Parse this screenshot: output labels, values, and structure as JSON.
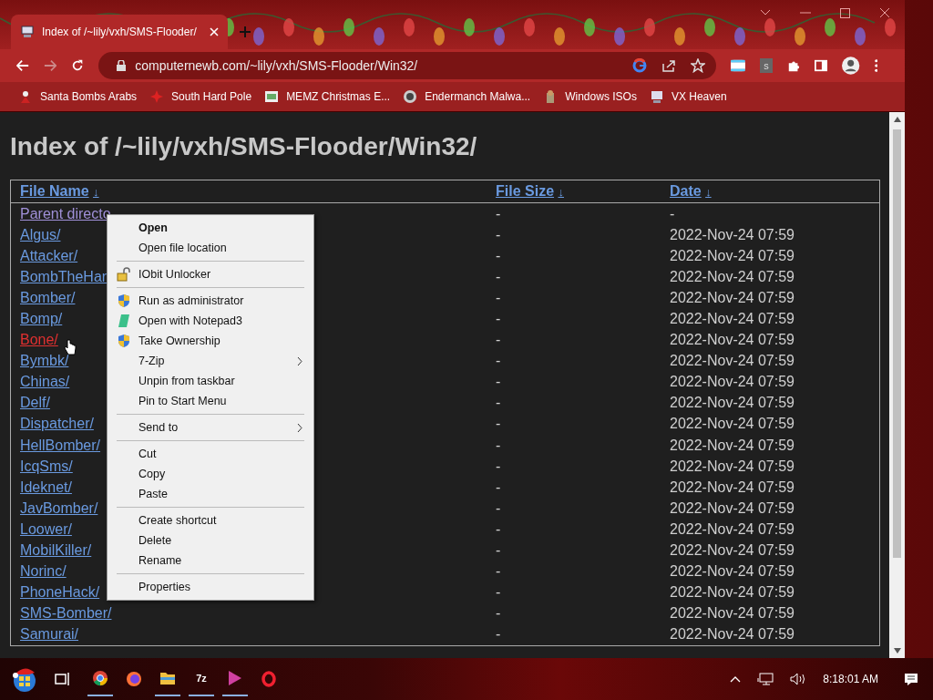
{
  "browser": {
    "tab": {
      "title": "Index of /~lily/vxh/SMS-Flooder/",
      "selected": true
    },
    "address": "computernewb.com/~lily/vxh/SMS-Flooder/Win32/",
    "extension_badge": "s",
    "bookmarks": [
      {
        "label": "Santa Bombs Arabs"
      },
      {
        "label": "South Hard Pole"
      },
      {
        "label": "MEMZ Christmas E..."
      },
      {
        "label": "Endermanch Malwa..."
      },
      {
        "label": "Windows ISOs"
      },
      {
        "label": "VX Heaven"
      }
    ]
  },
  "page": {
    "heading": "Index of /~lily/vxh/SMS-Flooder/Win32/",
    "columns": [
      {
        "label": "File Name",
        "sort": "↓"
      },
      {
        "label": "File Size",
        "sort": "↓"
      },
      {
        "label": "Date",
        "sort": "↓"
      }
    ],
    "rows": [
      {
        "name": "Parent directo",
        "size": "-",
        "date": "-",
        "visited": true,
        "hovered": false
      },
      {
        "name": "Algus/",
        "size": "-",
        "date": "2022-Nov-24 07:59",
        "visited": false,
        "hovered": false
      },
      {
        "name": "Attacker/",
        "size": "-",
        "date": "2022-Nov-24 07:59",
        "visited": false,
        "hovered": false
      },
      {
        "name": "BombTheHar",
        "size": "-",
        "date": "2022-Nov-24 07:59",
        "visited": false,
        "hovered": false
      },
      {
        "name": "Bomber/",
        "size": "-",
        "date": "2022-Nov-24 07:59",
        "visited": false,
        "hovered": false
      },
      {
        "name": "Bomp/",
        "size": "-",
        "date": "2022-Nov-24 07:59",
        "visited": false,
        "hovered": false
      },
      {
        "name": "Bone/",
        "size": "-",
        "date": "2022-Nov-24 07:59",
        "visited": false,
        "hovered": true
      },
      {
        "name": "Bymbk/",
        "size": "-",
        "date": "2022-Nov-24 07:59",
        "visited": false,
        "hovered": false
      },
      {
        "name": "Chinas/",
        "size": "-",
        "date": "2022-Nov-24 07:59",
        "visited": false,
        "hovered": false
      },
      {
        "name": "Delf/",
        "size": "-",
        "date": "2022-Nov-24 07:59",
        "visited": false,
        "hovered": false
      },
      {
        "name": "Dispatcher/",
        "size": "-",
        "date": "2022-Nov-24 07:59",
        "visited": false,
        "hovered": false
      },
      {
        "name": "HellBomber/",
        "size": "-",
        "date": "2022-Nov-24 07:59",
        "visited": false,
        "hovered": false
      },
      {
        "name": "IcqSms/",
        "size": "-",
        "date": "2022-Nov-24 07:59",
        "visited": false,
        "hovered": false
      },
      {
        "name": "Ideknet/",
        "size": "-",
        "date": "2022-Nov-24 07:59",
        "visited": false,
        "hovered": false
      },
      {
        "name": "JavBomber/",
        "size": "-",
        "date": "2022-Nov-24 07:59",
        "visited": false,
        "hovered": false
      },
      {
        "name": "Loower/",
        "size": "-",
        "date": "2022-Nov-24 07:59",
        "visited": false,
        "hovered": false
      },
      {
        "name": "MobilKiller/",
        "size": "-",
        "date": "2022-Nov-24 07:59",
        "visited": false,
        "hovered": false
      },
      {
        "name": "Norinc/",
        "size": "-",
        "date": "2022-Nov-24 07:59",
        "visited": false,
        "hovered": false
      },
      {
        "name": "PhoneHack/",
        "size": "-",
        "date": "2022-Nov-24 07:59",
        "visited": false,
        "hovered": false
      },
      {
        "name": "SMS-Bomber/",
        "size": "-",
        "date": "2022-Nov-24 07:59",
        "visited": false,
        "hovered": false
      },
      {
        "name": "Samurai/",
        "size": "-",
        "date": "2022-Nov-24 07:59",
        "visited": false,
        "hovered": false
      }
    ]
  },
  "context_menu": [
    {
      "kind": "item",
      "label": "Open",
      "bold": true
    },
    {
      "kind": "item",
      "label": "Open file location",
      "bold": false
    },
    {
      "kind": "separator"
    },
    {
      "kind": "item",
      "label": "IObit Unlocker",
      "bold": false
    },
    {
      "kind": "separator"
    },
    {
      "kind": "item",
      "label": "Run as administrator",
      "bold": false
    },
    {
      "kind": "item",
      "label": "Open with Notepad3",
      "bold": false
    },
    {
      "kind": "item",
      "label": "Take Ownership",
      "bold": false
    },
    {
      "kind": "submenu",
      "label": "7-Zip",
      "bold": false
    },
    {
      "kind": "item",
      "label": "Unpin from taskbar",
      "bold": false
    },
    {
      "kind": "item",
      "label": "Pin to Start Menu",
      "bold": false
    },
    {
      "kind": "separator"
    },
    {
      "kind": "submenu",
      "label": "Send to",
      "bold": false
    },
    {
      "kind": "separator"
    },
    {
      "kind": "item",
      "label": "Cut",
      "bold": false
    },
    {
      "kind": "item",
      "label": "Copy",
      "bold": false
    },
    {
      "kind": "item",
      "label": "Paste",
      "bold": false
    },
    {
      "kind": "separator"
    },
    {
      "kind": "item",
      "label": "Create shortcut",
      "bold": false
    },
    {
      "kind": "item",
      "label": "Delete",
      "bold": false
    },
    {
      "kind": "item",
      "label": "Rename",
      "bold": false
    },
    {
      "kind": "separator"
    },
    {
      "kind": "item",
      "label": "Properties",
      "bold": false
    }
  ],
  "taskbar": {
    "archiver_label": "7z",
    "clock": "8:18:01 AM"
  }
}
